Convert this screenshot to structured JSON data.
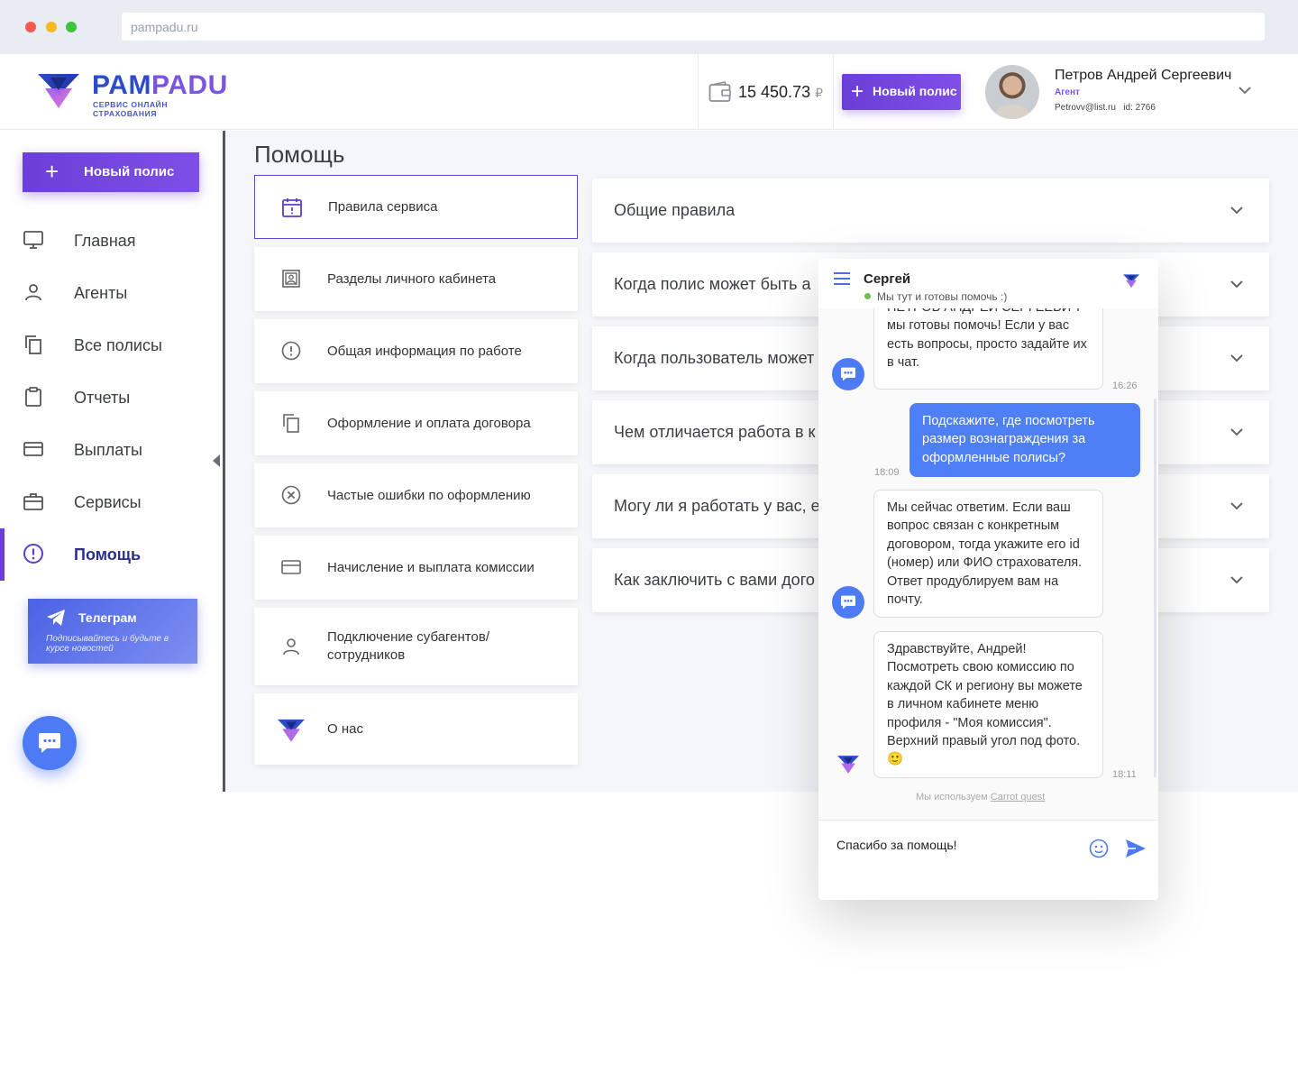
{
  "browser": {
    "url": "pampadu.ru"
  },
  "header": {
    "logo": {
      "part1": "PAM",
      "part2": "PADU",
      "tagline": "СЕРВИС ОНЛАЙН СТРАХОВАНИЯ"
    },
    "balance": {
      "amount": "15 450.73",
      "currency": "₽"
    },
    "new_policy_label": "Новый полис",
    "user": {
      "name": "Петров Андрей Сергеевич",
      "role": "Агент",
      "email": "Petrovv@list.ru",
      "id": "id: 2766"
    }
  },
  "sidebar": {
    "new_policy_label": "Новый полис",
    "items": [
      {
        "label": "Главная",
        "icon": "monitor-icon"
      },
      {
        "label": "Агенты",
        "icon": "person-icon"
      },
      {
        "label": "Все полисы",
        "icon": "copy-icon"
      },
      {
        "label": "Отчеты",
        "icon": "clipboard-icon"
      },
      {
        "label": "Выплаты",
        "icon": "credit-card-icon"
      },
      {
        "label": "Сервисы",
        "icon": "briefcase-icon"
      },
      {
        "label": "Помощь",
        "icon": "alert-circle-icon",
        "active": true
      }
    ],
    "telegram": {
      "title": "Телеграм",
      "text": "Подписывайтесь и будьте в курсе новостей"
    }
  },
  "main": {
    "title": "Помощь",
    "categories": [
      {
        "label": "Правила сервиса",
        "icon": "calendar-icon"
      },
      {
        "label": "Разделы личного кабинета",
        "icon": "portrait-icon"
      },
      {
        "label": "Общая информация по работе",
        "icon": "info-circle-icon"
      },
      {
        "label": "Оформление и оплата договора",
        "icon": "copy-icon"
      },
      {
        "label": "Частые ошибки по оформлению",
        "icon": "x-circle-icon"
      },
      {
        "label": "Начисление и выплата комиссии",
        "icon": "credit-card-icon"
      },
      {
        "label": "Подключение субагентов/ сотрудников",
        "icon": "person-icon"
      },
      {
        "label": "О нас",
        "icon": "pampadu-logo-icon"
      }
    ],
    "faq": [
      "Общие правила",
      "Когда полис может быть а",
      "Когда пользователь может",
      "Чем отличается работа в к",
      "Могу ли я работать у вас, е",
      "Как заключить с вами дого"
    ]
  },
  "chat": {
    "agent_name": "Сергей",
    "status": "Мы тут и готовы помочь :)",
    "messages": [
      {
        "from": "bot",
        "text": "ПЕТРОВ АНДРЕЙ СЕРГЕЕВИЧ мы готовы помочь! Если у вас есть вопросы, просто задайте их в чат.",
        "time": "16:26"
      },
      {
        "from": "me",
        "text": "Подскажите, где посмотреть размер вознаграждения за оформленные полисы?",
        "time": "18:09"
      },
      {
        "from": "bot",
        "text": "Мы сейчас ответим. Если ваш вопрос связан с конкретным договором, тогда укажите его id (номер) или ФИО страхователя. Ответ продублируем вам на почту.",
        "time": ""
      },
      {
        "from": "agent",
        "text": "Здравствуйте, Андрей! Посмотреть свою комиссию по каждой СК и региону вы можете в личном кабинете меню профиля - \"Моя комиссия\". Верхний правый угол под фото. 🙂",
        "time": "18:11"
      }
    ],
    "powered_prefix": "Мы используем",
    "powered_link": "Carrot quest",
    "input_value": "Спасибо за помощь!"
  }
}
